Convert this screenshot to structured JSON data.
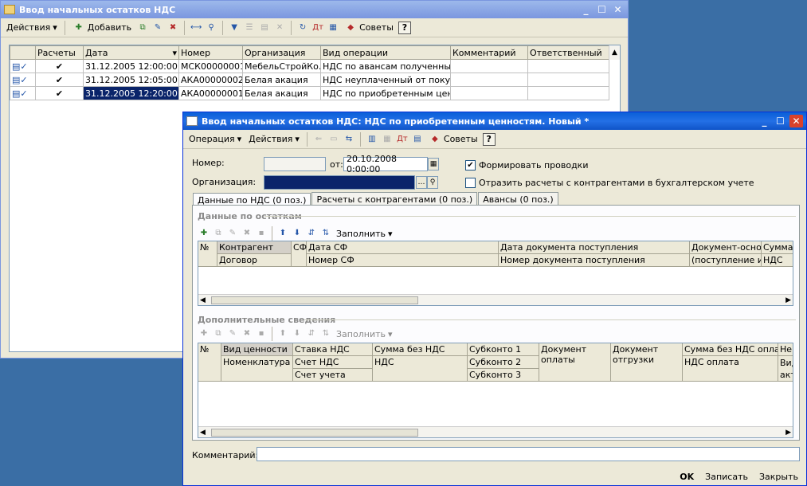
{
  "back_window": {
    "title": "Ввод начальных остатков НДС",
    "toolbar": {
      "actions": "Действия",
      "add": "Добавить"
    },
    "columns": [
      "",
      "Расчеты",
      "Дата",
      "Номер",
      "Организация",
      "Вид операции",
      "Комментарий",
      "Ответственный"
    ],
    "rows": [
      {
        "check": "✔",
        "date": "31.12.2005 12:00:00",
        "number": "МСК00000001",
        "org": "МебельСтройКо...",
        "op": "НДС по авансам полученным",
        "comment": "",
        "resp": ""
      },
      {
        "check": "✔",
        "date": "31.12.2005 12:05:00",
        "number": "АКА00000002",
        "org": "Белая акация",
        "op": "НДС неуплаченный от покуп...",
        "comment": "",
        "resp": ""
      },
      {
        "check": "✔",
        "date": "31.12.2005 12:20:00",
        "number": "АКА00000001",
        "org": "Белая акация",
        "op": "НДС по приобретенным ценн...",
        "comment": "",
        "resp": ""
      }
    ]
  },
  "front_window": {
    "title": "Ввод начальных остатков НДС: НДС по приобретенным ценностям. Новый *",
    "toolbar": {
      "operation": "Операция",
      "actions": "Действия",
      "tips": "Советы"
    },
    "number_label": "Номер:",
    "number_value": "",
    "from_label": "от:",
    "date_value": "20.10.2008 0:00:00",
    "org_label": "Организация:",
    "org_value": "",
    "check_post": "Формировать проводки",
    "check_reflect": "Отразить расчеты с контрагентами в бухгалтерском учете",
    "tabs": [
      "Данные по НДС (0 поз.)",
      "Расчеты с контрагентами (0 поз.)",
      "Авансы (0 поз.)"
    ],
    "section1": {
      "title": "Данные по остаткам",
      "fill": "Заполнить",
      "headers_row1": [
        "№",
        "Контрагент",
        "СФ",
        "Дата СФ",
        "Дата документа поступления",
        "Документ-осно...",
        "Сумма"
      ],
      "headers_row2": [
        "Договор",
        "Номер СФ",
        "Номер документа поступления",
        "(поступление и",
        "НДС"
      ]
    },
    "section2": {
      "title": "Дополнительные сведения",
      "fill": "Заполнить",
      "h1": [
        "№",
        "Вид ценности",
        "Ставка НДС",
        "Сумма без НДС",
        "Субконто 1",
        "Документ",
        "Документ",
        "Сумма без НДС опла...",
        "Не"
      ],
      "h2": [
        "Номенклатура",
        "Счет НДС",
        "НДС",
        "Субконто 2",
        "оплаты",
        "отгрузки",
        "НДС оплата",
        "Вид"
      ],
      "h3": [
        "Счет учета",
        "Субконто 3",
        "акт"
      ]
    },
    "comment_label": "Комментарий:",
    "comment_value": "",
    "footer": {
      "ok": "OK",
      "save": "Записать",
      "close": "Закрыть"
    }
  }
}
